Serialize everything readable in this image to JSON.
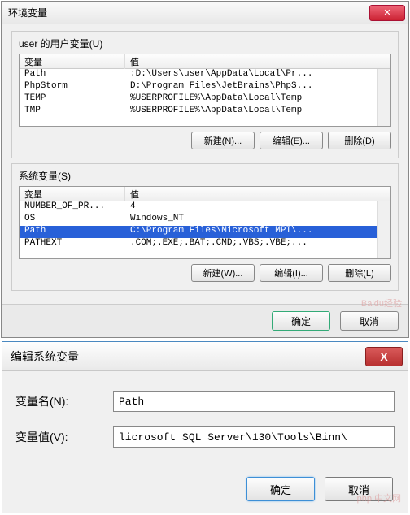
{
  "env_dialog": {
    "title": "环境变量",
    "user_group": "user 的用户变量(U)",
    "sys_group": "系统变量(S)",
    "col_var": "变量",
    "col_val": "值",
    "user_vars": [
      {
        "n": "Path",
        "v": ":D:\\Users\\user\\AppData\\Local\\Pr..."
      },
      {
        "n": "PhpStorm",
        "v": "D:\\Program Files\\JetBrains\\PhpS..."
      },
      {
        "n": "TEMP",
        "v": "%USERPROFILE%\\AppData\\Local\\Temp"
      },
      {
        "n": "TMP",
        "v": "%USERPROFILE%\\AppData\\Local\\Temp"
      }
    ],
    "sys_vars": [
      {
        "n": "NUMBER_OF_PR...",
        "v": "4"
      },
      {
        "n": "OS",
        "v": "Windows_NT"
      },
      {
        "n": "Path",
        "v": "C:\\Program Files\\Microsoft MPI\\...",
        "sel": true
      },
      {
        "n": "PATHEXT",
        "v": ".COM;.EXE;.BAT;.CMD;.VBS;.VBE;..."
      }
    ],
    "btn_new": "新建(N)...",
    "btn_edit": "编辑(E)...",
    "btn_del": "删除(D)",
    "btn_new2": "新建(W)...",
    "btn_edit2": "编辑(I)...",
    "btn_del2": "删除(L)",
    "ok": "确定",
    "cancel": "取消"
  },
  "edit_dialog": {
    "title": "编辑系统变量",
    "label_name": "变量名(N):",
    "label_value": "变量值(V):",
    "name_value": "Path",
    "value_value": "licrosoft SQL Server\\130\\Tools\\Binn\\",
    "ok": "确定",
    "cancel": "取消"
  },
  "watermarks": {
    "w1": "Baidu经验",
    "w2": "php 中文网"
  }
}
